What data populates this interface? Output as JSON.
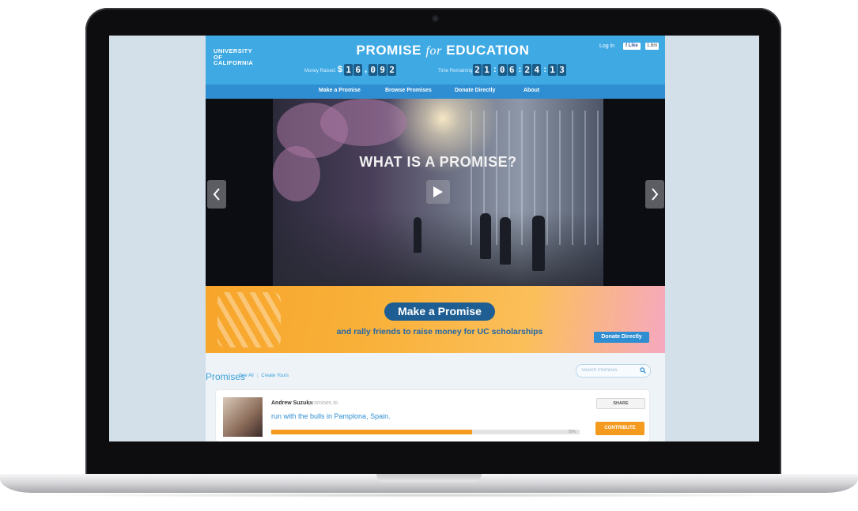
{
  "header": {
    "logo_lines": [
      "UNIVERSITY",
      "OF",
      "CALIFORNIA"
    ],
    "title_part1": "PROMISE",
    "title_for": "for",
    "title_part2": "EDUCATION",
    "login_label": "Log in",
    "fb_like_label": "Like",
    "fb_like_count": "1.6m",
    "money_raised_label": "Money Raised:",
    "money_raised_chars": [
      "$",
      "1",
      "6",
      ",",
      "0",
      "9",
      "2"
    ],
    "time_remaining_label": "Time Remaining:",
    "time_remaining_chars": [
      "2",
      "1",
      ":",
      "0",
      "6",
      ":",
      "2",
      "4",
      ":",
      "1",
      "3"
    ]
  },
  "nav": {
    "items": [
      "Make a Promise",
      "Browse Promises",
      "Donate Directly",
      "About"
    ]
  },
  "hero": {
    "title": "WHAT IS A PROMISE?",
    "play_icon": "play-icon",
    "prev_icon": "chevron-left-icon",
    "next_icon": "chevron-right-icon"
  },
  "promo": {
    "button_label": "Make a Promise",
    "subtext": "and rally friends to raise money for UC scholarships",
    "donate_label": "Donate Directly"
  },
  "promises": {
    "heading": "Promises",
    "see_all": "See All",
    "separator": "|",
    "create_yours": "Create Yours",
    "search_placeholder": "Search Promises"
  },
  "card": {
    "user_name": "Andrew Suzuka",
    "verb": "promises to",
    "promise_text": "run with the bulls in Pamplona, Spain.",
    "progress_fraction": 0.65,
    "progress_label": "70%",
    "share_label": "SHARE",
    "contribute_label": "CONTRIBUTE"
  },
  "colors": {
    "header_blue": "#3fa9e4",
    "nav_blue": "#2f8ed1",
    "digit_box": "#1b5c88",
    "accent_orange": "#f39a1f",
    "promo_button": "#1f5e93"
  }
}
